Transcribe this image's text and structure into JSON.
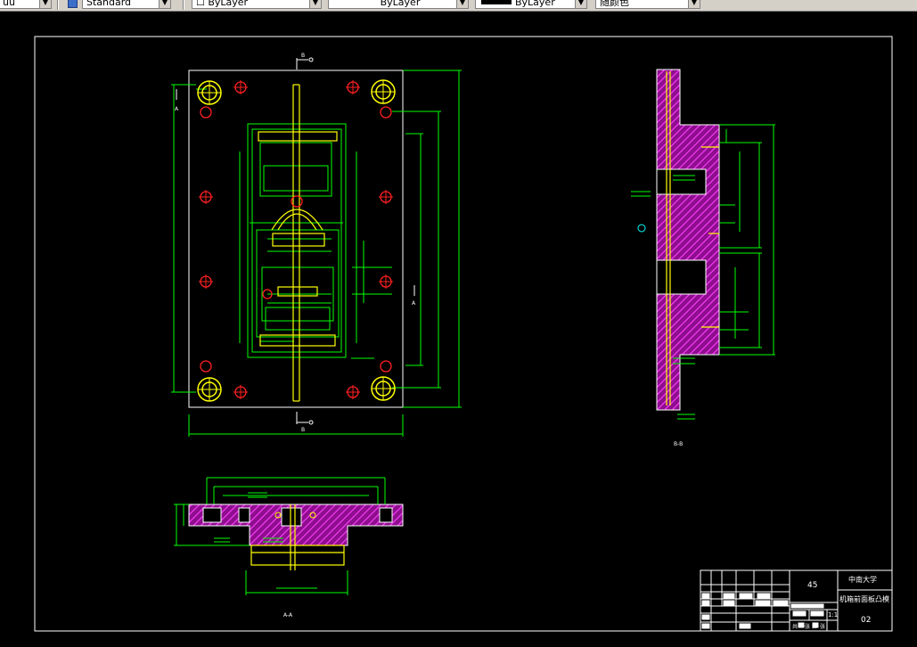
{
  "toolbar": {
    "text_style_value": "Standard",
    "layer_value": "ByLayer",
    "linetype_value": "ByLayer",
    "lineweight_value": "ByLayer",
    "plotstyle_value": "随颜色"
  },
  "views": {
    "section_bb_label": "B-B",
    "section_aa_label": "A-A",
    "cut_marker_b": "B",
    "cut_marker_a": "A"
  },
  "title_block": {
    "material": "45",
    "school": "中南大学",
    "part_name": "机箱前面板凸模",
    "scale": "1:1",
    "drawing_number": "02",
    "sheet_count_prefix": "共",
    "sheet_count_suffix": "张",
    "sheet_index_prefix": "第",
    "sheet_index_suffix": "张"
  },
  "colors": {
    "outline": "#00ff00",
    "hatch": "#ff00ff",
    "holes": "#ff0000",
    "accent": "#ffff00",
    "border": "#ffffff"
  }
}
